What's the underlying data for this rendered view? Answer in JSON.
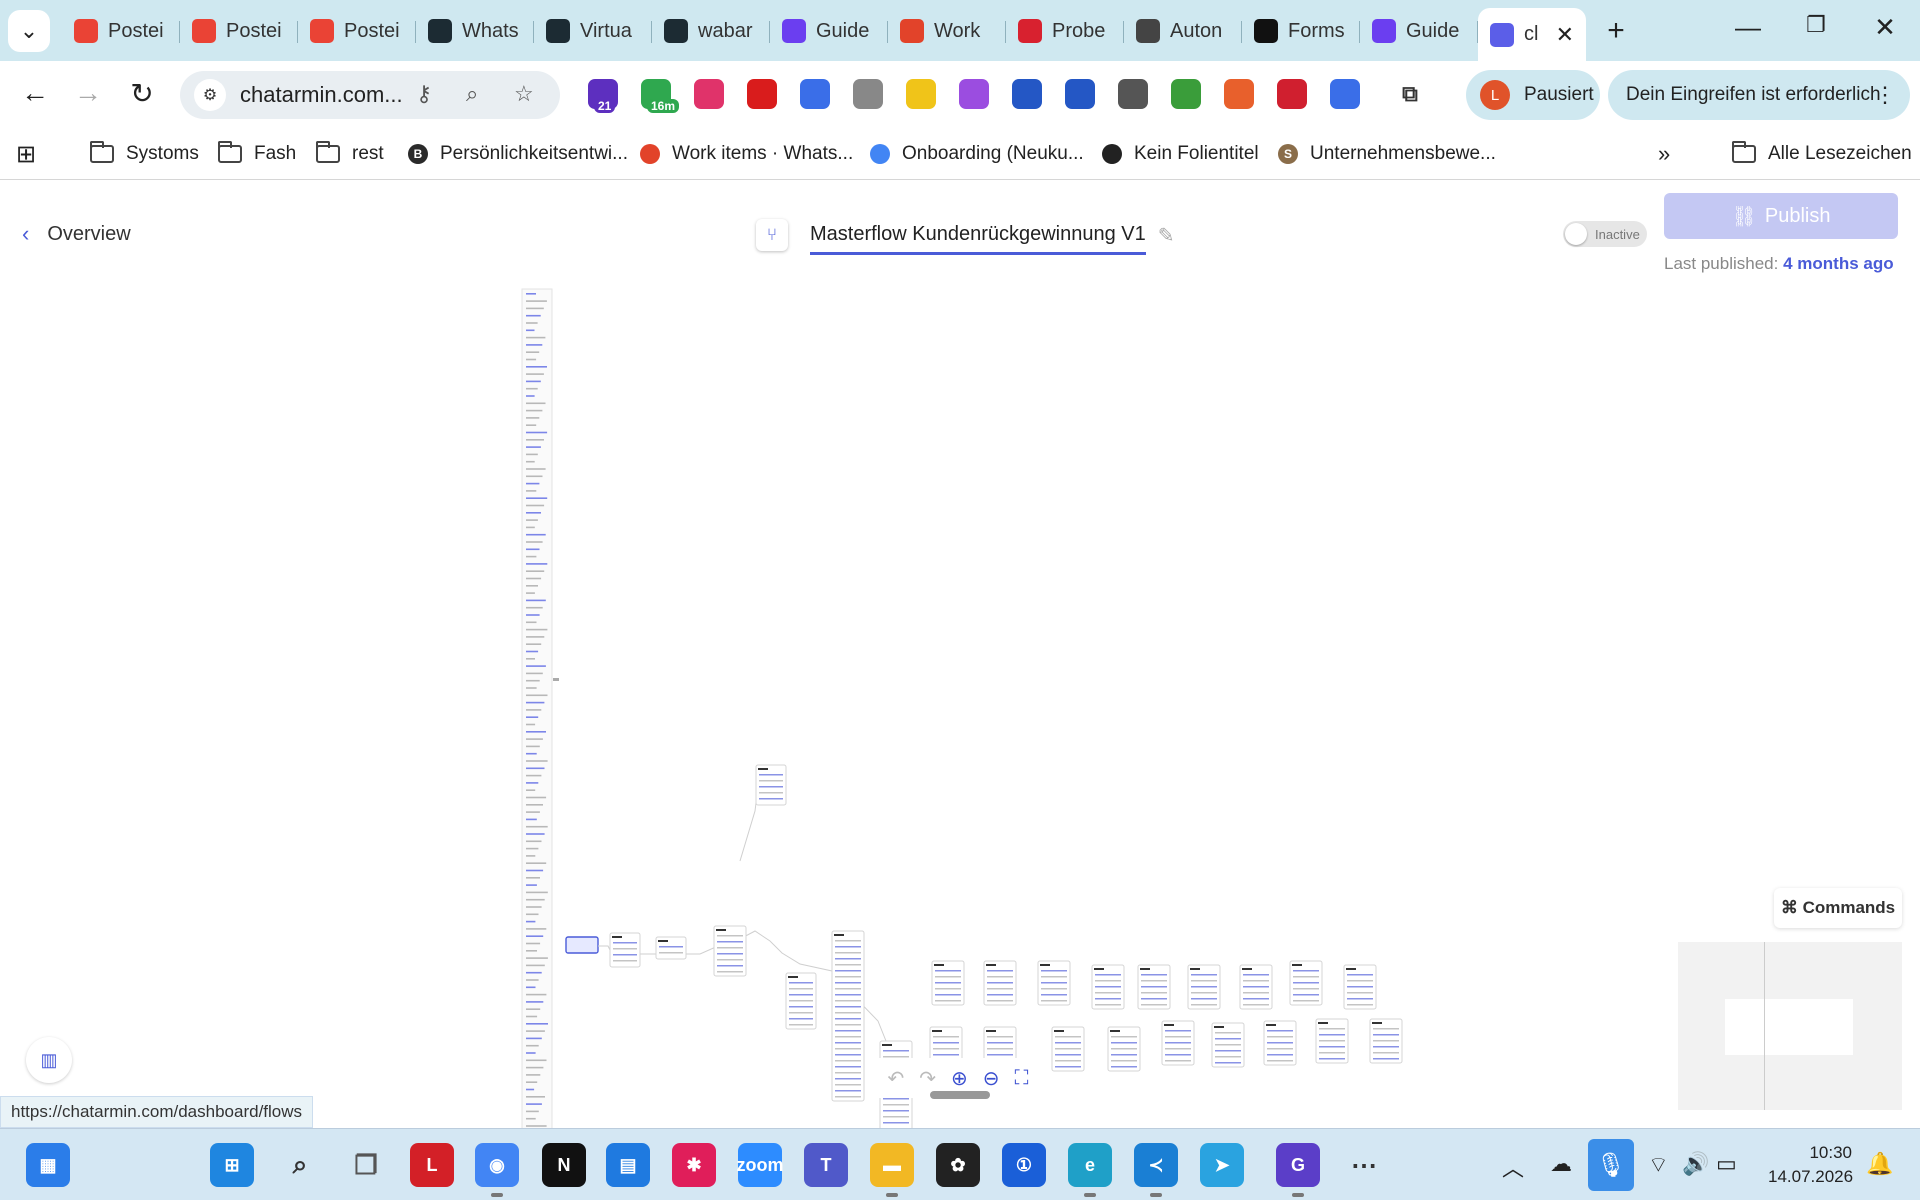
{
  "browser": {
    "tabs": [
      {
        "label": "Postei",
        "icon": "gmail",
        "color": "#ea4335"
      },
      {
        "label": "Postei",
        "icon": "gmail",
        "color": "#ea4335"
      },
      {
        "label": "Postei",
        "icon": "gmail",
        "color": "#ea4335"
      },
      {
        "label": "Whats",
        "icon": "360dialog",
        "color": "#1c2b33"
      },
      {
        "label": "Virtua",
        "icon": "360dialog",
        "color": "#1c2b33"
      },
      {
        "label": "wabar",
        "icon": "360dialog",
        "color": "#1c2b33"
      },
      {
        "label": "Guide",
        "icon": "guidde",
        "color": "#6b3ef0"
      },
      {
        "label": "Work",
        "icon": "gitlab",
        "color": "#e2432a"
      },
      {
        "label": "Probe",
        "icon": "fit",
        "color": "#d8212f"
      },
      {
        "label": "Auton",
        "icon": "automation",
        "color": "#444444"
      },
      {
        "label": "Forms",
        "icon": "forms",
        "color": "#111111"
      },
      {
        "label": "Guide",
        "icon": "guidde",
        "color": "#6b3ef0"
      }
    ],
    "active_tab": {
      "label": "cl",
      "icon": "chatarmin",
      "color": "#5b5ee8"
    },
    "url": "chatarmin.com...",
    "extensions": [
      {
        "name": "home-ext-icon",
        "badge": "21",
        "color": "#5d2fbf"
      },
      {
        "name": "timer-ext-icon",
        "badge": "16m",
        "color": "#2fa84f"
      },
      {
        "name": "grid-ext-icon",
        "badge": "",
        "color": "#e0336a"
      },
      {
        "name": "eyedropper-ext-icon",
        "badge": "",
        "color": "#d91c1c"
      },
      {
        "name": "c-ext-icon",
        "badge": "",
        "color": "#3a6ee8"
      },
      {
        "name": "camera-ext-icon",
        "badge": "",
        "color": "#888888"
      },
      {
        "name": "face-ext-icon",
        "badge": "",
        "color": "#f0c419"
      },
      {
        "name": "ring-ext-icon",
        "badge": "",
        "color": "#9b4de0"
      },
      {
        "name": "cloud-ext-icon",
        "badge": "",
        "color": "#2457c5"
      },
      {
        "name": "lock-ext-icon",
        "badge": "",
        "color": "#2457c5"
      },
      {
        "name": "clock-ext-icon",
        "badge": "",
        "color": "#555555"
      },
      {
        "name": "frog-ext-icon",
        "badge": "",
        "color": "#3a9d3a"
      },
      {
        "name": "fox-ext-icon",
        "badge": "",
        "color": "#e8602c"
      },
      {
        "name": "g-ext-icon",
        "badge": "",
        "color": "#d01f2f"
      },
      {
        "name": "snowflake-ext-icon",
        "badge": "",
        "color": "#3a6ee8"
      }
    ],
    "profile": {
      "initial": "L",
      "label": "Pausiert"
    },
    "alert": "Dein Eingreifen ist erforderlich"
  },
  "bookmarks": [
    {
      "label": "Systoms",
      "type": "folder"
    },
    {
      "label": "Fash",
      "type": "folder"
    },
    {
      "label": "rest",
      "type": "folder"
    },
    {
      "label": "Persönlichkeitsentwi...",
      "type": "site",
      "icon_letter": "B",
      "color": "#2a2a2a"
    },
    {
      "label": "Work items · Whats...",
      "type": "site",
      "icon_letter": "",
      "color": "#e2432a"
    },
    {
      "label": "Onboarding (Neuku...",
      "type": "site",
      "icon_letter": "",
      "color": "#4285f4"
    },
    {
      "label": "Kein Folientitel",
      "type": "site",
      "icon_letter": "",
      "color": "#222222"
    },
    {
      "label": "Unternehmensbewe...",
      "type": "site",
      "icon_letter": "S",
      "color": "#8a6d4a"
    }
  ],
  "bookmarks_all": "Alle Lesezeichen",
  "header": {
    "back_label": "Overview",
    "flow_name": "Masterflow Kundenrückgewinnung V1",
    "toggle_label": "Inactive",
    "publish_label": "Publish",
    "last_published_prefix": "Last published:",
    "last_published_value": "4 months ago"
  },
  "canvas": {
    "commands_label": "⌘ Commands"
  },
  "status_url": "https://chatarmin.com/dashboard/flows",
  "taskbar": {
    "apps": [
      {
        "name": "widgets-icon",
        "color": "#2b7de9",
        "glyph": "▦"
      },
      {
        "name": "windows-start-icon",
        "color": "#1f86e0",
        "glyph": "⊞"
      },
      {
        "name": "search-icon",
        "color": "#333333",
        "glyph": "⌕"
      },
      {
        "name": "task-view-icon",
        "color": "#555555",
        "glyph": "❐"
      },
      {
        "name": "l-app-icon",
        "color": "#d32027",
        "glyph": "L"
      },
      {
        "name": "chrome-icon",
        "color": "#4285f4",
        "glyph": "◉"
      },
      {
        "name": "notion-icon",
        "color": "#111111",
        "glyph": "N"
      },
      {
        "name": "store-icon",
        "color": "#1f7ae0",
        "glyph": "▤"
      },
      {
        "name": "slack-icon",
        "color": "#e01e5a",
        "glyph": "✱"
      },
      {
        "name": "zoom-icon",
        "color": "#2d8cff",
        "glyph": "zoom"
      },
      {
        "name": "teams-icon",
        "color": "#5059c9",
        "glyph": "T"
      },
      {
        "name": "file-explorer-icon",
        "color": "#f2b824",
        "glyph": "▬"
      },
      {
        "name": "chatgpt-icon",
        "color": "#222222",
        "glyph": "✿"
      },
      {
        "name": "1password-icon",
        "color": "#1a5fd8",
        "glyph": "①"
      },
      {
        "name": "edge-icon",
        "color": "#1fa0c8",
        "glyph": "e"
      },
      {
        "name": "vscode-icon",
        "color": "#1a7fd4",
        "glyph": "≺"
      },
      {
        "name": "telegram-icon",
        "color": "#2aa3e0",
        "glyph": "➤"
      },
      {
        "name": "guidde-icon",
        "color": "#5b3ec8",
        "glyph": "G"
      },
      {
        "name": "more-apps-icon",
        "color": "#333333",
        "glyph": "⋯"
      }
    ],
    "time": "10:30",
    "date": "14.07.2026"
  }
}
